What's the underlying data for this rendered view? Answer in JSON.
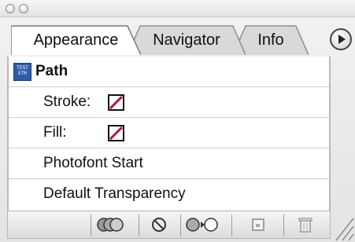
{
  "window": {
    "controls": [
      "close-button",
      "minimize-button"
    ]
  },
  "tabs": [
    {
      "label": "Appearance",
      "active": true
    },
    {
      "label": "Navigator",
      "active": false
    },
    {
      "label": "Info",
      "active": false
    }
  ],
  "object": {
    "thumbnail_text": [
      "TEST",
      "STR"
    ],
    "label": "Path"
  },
  "attributes": [
    {
      "label": "Stroke:",
      "swatch": "none"
    },
    {
      "label": "Fill:",
      "swatch": "none"
    },
    {
      "label": "Photofont Start"
    },
    {
      "label": "Default Transparency"
    }
  ],
  "toolbar": {
    "buttons": [
      "new-art-basic-appearance",
      "clear-appearance",
      "reduce-to-basic-appearance",
      "duplicate-item",
      "delete-item"
    ]
  },
  "colors": {
    "none_slash": "#b01838",
    "thumbnail_bg": "#2f5aa8"
  }
}
